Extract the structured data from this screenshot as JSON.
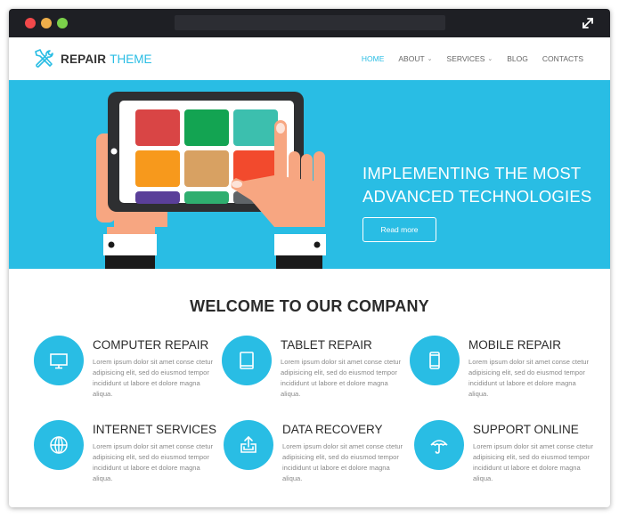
{
  "window": {
    "controls": [
      "close",
      "minimize",
      "maximize"
    ],
    "expand_icon": "expand-arrows-icon"
  },
  "header": {
    "logo_icon": "wrench-screwdriver-icon",
    "brand_primary": "REPAIR",
    "brand_accent": "THEME",
    "nav": [
      {
        "label": "HOME",
        "active": true,
        "dropdown": false
      },
      {
        "label": "ABOUT",
        "active": false,
        "dropdown": true
      },
      {
        "label": "SERVICES",
        "active": false,
        "dropdown": true
      },
      {
        "label": "BLOG",
        "active": false,
        "dropdown": false
      },
      {
        "label": "CONTACTS",
        "active": false,
        "dropdown": false
      }
    ],
    "chevron": "⌄"
  },
  "hero": {
    "title_line1": "IMPLEMENTING THE MOST",
    "title_line2": "ADVANCED TECHNOLOGIES",
    "button_label": "Read more",
    "illustration": "hands-holding-tablet",
    "tile_colors": [
      "#d94545",
      "#13a452",
      "#3cbfae",
      "#f7991c",
      "#d8a162",
      "#f24a2d",
      "#5a3f99",
      "#2fae6f",
      "#5f6468"
    ]
  },
  "welcome": {
    "title": "WELCOME TO OUR COMPANY",
    "services": [
      {
        "title": "COMPUTER REPAIR",
        "icon": "monitor-icon",
        "description": "Lorem ipsum dolor sit amet conse ctetur adipisicing elit, sed do eiusmod tempor incididunt ut labore et dolore magna aliqua."
      },
      {
        "title": "TABLET REPAIR",
        "icon": "tablet-icon",
        "description": "Lorem ipsum dolor sit amet conse ctetur adipisicing elit, sed do eiusmod tempor incididunt ut labore et dolore magna aliqua."
      },
      {
        "title": "MOBILE REPAIR",
        "icon": "mobile-icon",
        "description": "Lorem ipsum dolor sit amet conse ctetur adipisicing elit, sed do eiusmod tempor incididunt ut labore et dolore magna aliqua."
      },
      {
        "title": "INTERNET SERVICES",
        "icon": "globe-icon",
        "description": "Lorem ipsum dolor sit amet conse ctetur adipisicing elit, sed do eiusmod tempor incididunt ut labore et dolore magna aliqua."
      },
      {
        "title": "DATA RECOVERY",
        "icon": "upload-icon",
        "description": "Lorem ipsum dolor sit amet conse ctetur adipisicing elit, sed do eiusmod tempor incididunt ut labore et dolore magna aliqua."
      },
      {
        "title": "SUPPORT ONLINE",
        "icon": "umbrella-icon",
        "description": "Lorem ipsum dolor sit amet conse ctetur adipisicing elit, sed do eiusmod tempor incididunt ut labore et dolore magna aliqua."
      }
    ]
  },
  "colors": {
    "accent": "#29bde4",
    "titlebar": "#1e1f24",
    "heading": "#2b2b2b",
    "body_text": "#8a8a8a"
  }
}
